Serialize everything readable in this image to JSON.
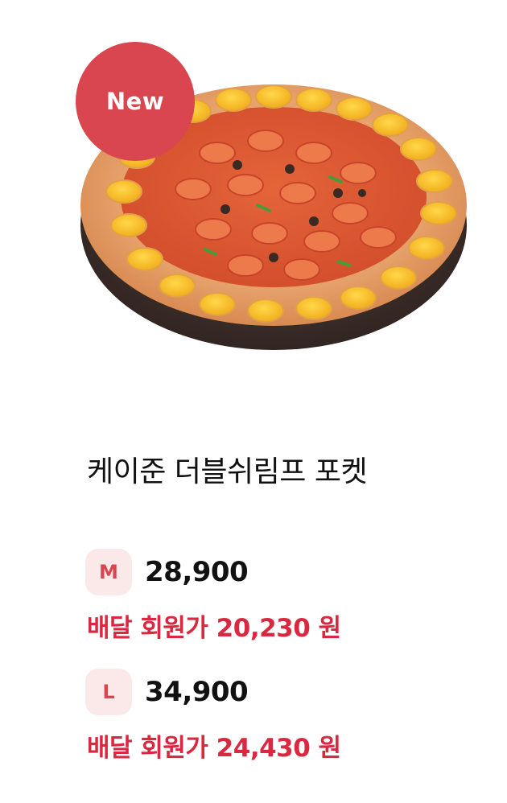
{
  "badge": {
    "label": "New"
  },
  "product": {
    "name": "케이준 더블쉬림프 포켓",
    "image_icon": "pizza-image"
  },
  "prices": [
    {
      "size": "M",
      "price": "28,900",
      "member_price": "배달 회원가 20,230 원"
    },
    {
      "size": "L",
      "price": "34,900",
      "member_price": "배달 회원가 24,430 원"
    }
  ],
  "colors": {
    "accent": "#d9464f",
    "member_price": "#d9283f",
    "size_badge_bg": "#fbe9ea",
    "text": "#111111"
  }
}
